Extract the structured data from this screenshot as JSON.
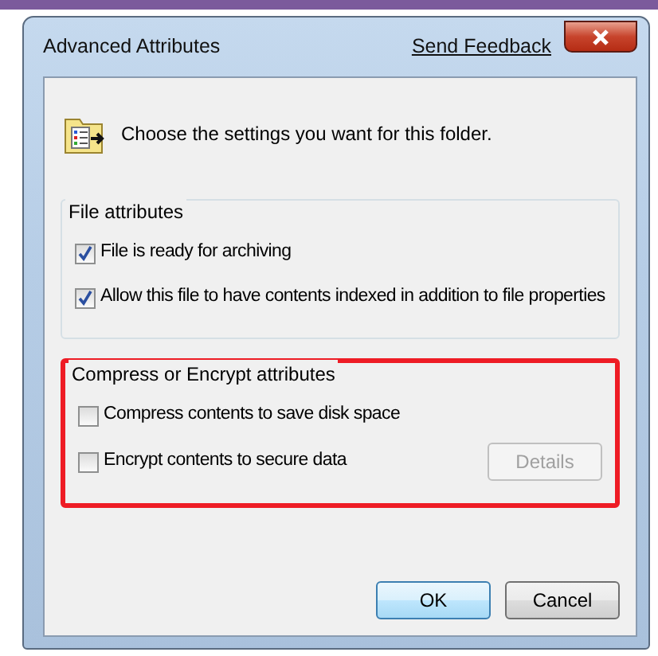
{
  "window": {
    "title": "Advanced Attributes",
    "feedback_link": "Send Feedback"
  },
  "intro": "Choose the settings you want for this folder.",
  "groups": [
    {
      "title": "File attributes",
      "highlighted": false,
      "options": [
        {
          "label": "File is ready for archiving",
          "checked": true
        },
        {
          "label": "Allow this file to have contents indexed in addition to file properties",
          "checked": true
        }
      ]
    },
    {
      "title": "Compress or Encrypt attributes",
      "highlighted": true,
      "options": [
        {
          "label": "Compress contents to save disk space",
          "checked": false
        },
        {
          "label": "Encrypt contents to secure data",
          "checked": false,
          "button": {
            "label": "Details",
            "disabled": true
          }
        }
      ]
    }
  ],
  "buttons": [
    {
      "label": "OK",
      "default": true
    },
    {
      "label": "Cancel",
      "default": false
    }
  ]
}
